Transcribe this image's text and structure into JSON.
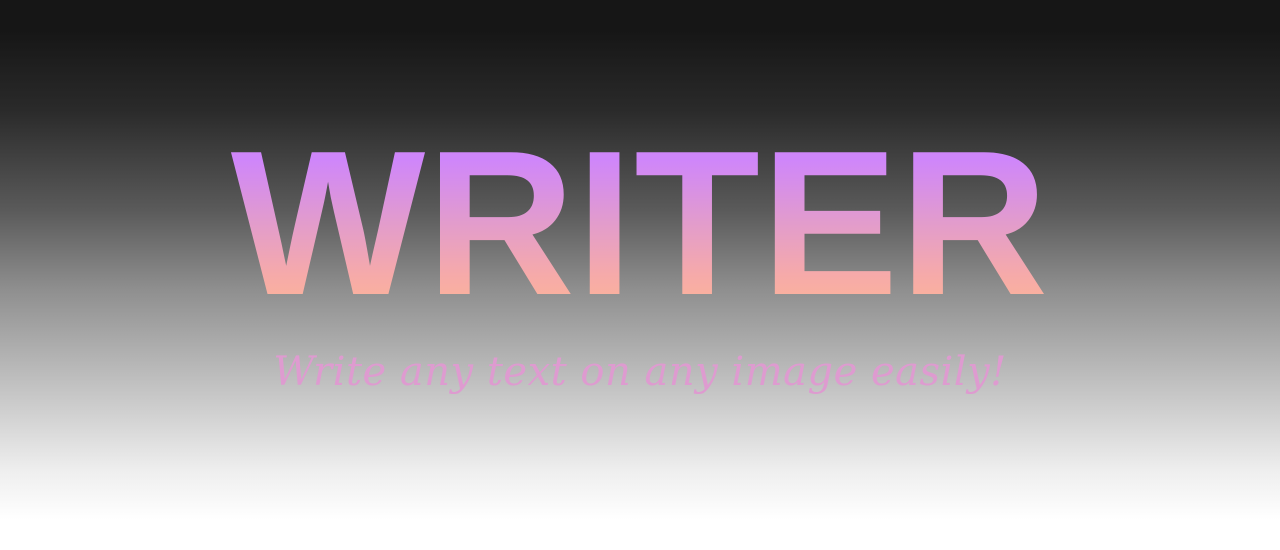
{
  "hero": {
    "title": "WRITER",
    "tagline": "Write any text on any image easily!"
  },
  "colors": {
    "title_gradient_top": "#cf86fa",
    "title_gradient_bottom": "#ffba90",
    "tagline": "#de9bd0",
    "background_top": "#161616",
    "background_bottom": "#ffffff"
  }
}
